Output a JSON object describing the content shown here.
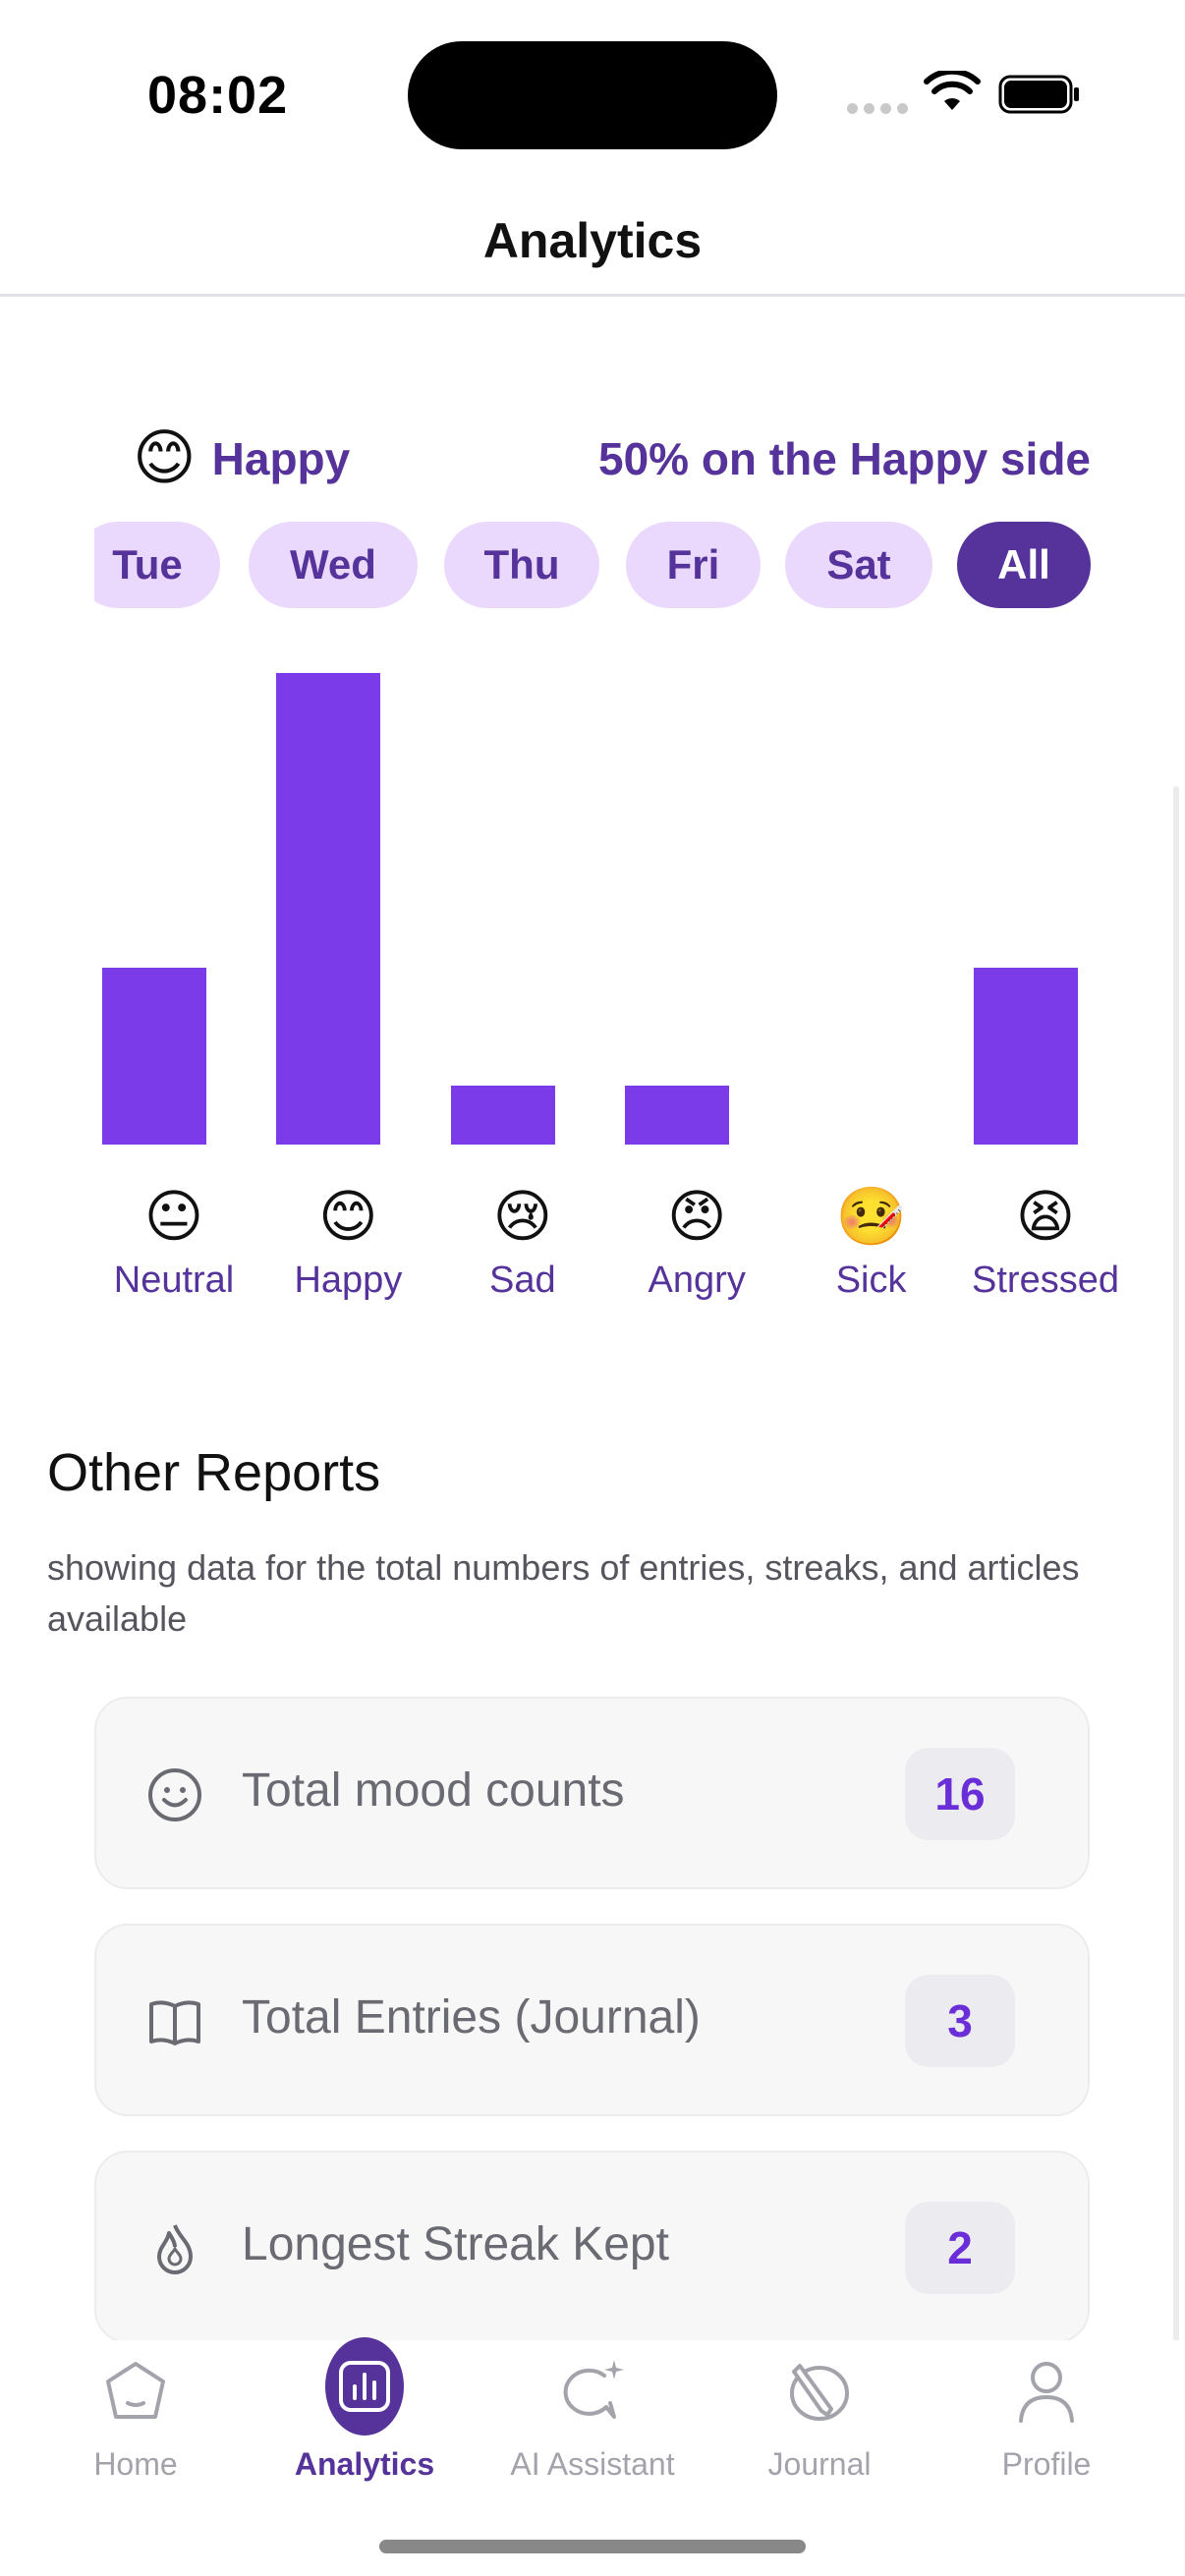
{
  "status_bar": {
    "time": "08:02"
  },
  "header": {
    "title": "Analytics"
  },
  "summary": {
    "emoji": "😊",
    "mood": "Happy",
    "percent_text": "50% on the Happy side"
  },
  "days": [
    {
      "label": "Tue",
      "active": false
    },
    {
      "label": "Wed",
      "active": false
    },
    {
      "label": "Thu",
      "active": false
    },
    {
      "label": "Fri",
      "active": false
    },
    {
      "label": "Sat",
      "active": false
    },
    {
      "label": "All",
      "active": true
    }
  ],
  "chart_data": {
    "type": "bar",
    "categories": [
      "Neutral",
      "Happy",
      "Sad",
      "Angry",
      "Sick",
      "Stressed"
    ],
    "emojis": [
      "😐",
      "😊",
      "😢",
      "😠",
      "🤒",
      "😫"
    ],
    "values": [
      3,
      8,
      1,
      1,
      0,
      3
    ],
    "ylim": [
      0,
      8
    ],
    "color": "#7b3be8"
  },
  "reports": {
    "title": "Other Reports",
    "description": "showing data for the total numbers of entries, streaks, and articles available",
    "cards": [
      {
        "icon": "smile-icon",
        "label": "Total mood counts",
        "value": "16"
      },
      {
        "icon": "book-icon",
        "label": "Total Entries (Journal)",
        "value": "3"
      },
      {
        "icon": "flame-icon",
        "label": "Longest Streak Kept",
        "value": "2"
      }
    ]
  },
  "tabbar": {
    "items": [
      {
        "icon": "home-icon",
        "label": "Home",
        "active": false
      },
      {
        "icon": "analytics-icon",
        "label": "Analytics",
        "active": true
      },
      {
        "icon": "ai-assistant-icon",
        "label": "AI Assistant",
        "active": false
      },
      {
        "icon": "journal-icon",
        "label": "Journal",
        "active": false
      },
      {
        "icon": "profile-icon",
        "label": "Profile",
        "active": false
      }
    ]
  },
  "colors": {
    "accent": "#55339b",
    "bar": "#7b3be8",
    "chip_bg": "#ead9fc"
  }
}
